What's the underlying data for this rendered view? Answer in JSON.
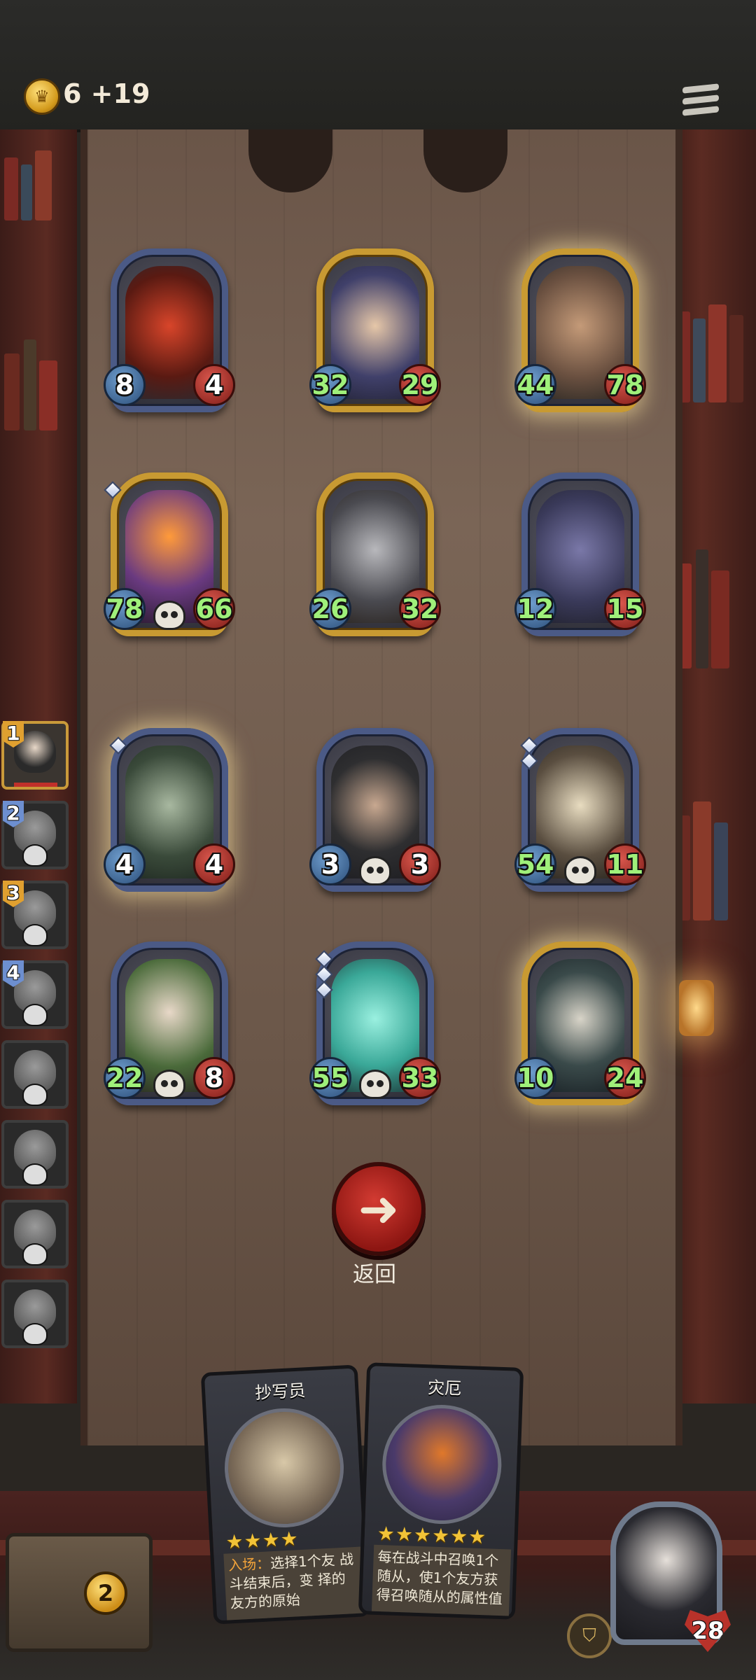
{
  "header": {
    "gold_icon": "coin-crown-icon",
    "gold_text": "6 +19",
    "menu_icon": "menu-icon"
  },
  "board_cards": [
    {
      "row": 1,
      "col": 1,
      "attack": "8",
      "health": "4",
      "frame": "blue",
      "skull": false,
      "gems": 0,
      "art": "red-dragon"
    },
    {
      "row": 1,
      "col": 2,
      "attack": "32",
      "health": "29",
      "frame": "gold",
      "skull": false,
      "gems": 0,
      "art": "helmeted-brute"
    },
    {
      "row": 1,
      "col": 3,
      "attack": "44",
      "health": "78",
      "frame": "gold",
      "skull": false,
      "gems": 0,
      "art": "bandaged-ogre"
    },
    {
      "row": 2,
      "col": 1,
      "attack": "78",
      "health": "66",
      "frame": "gold",
      "skull": true,
      "gems": 1,
      "art": "flaming-bulldog"
    },
    {
      "row": 2,
      "col": 2,
      "attack": "26",
      "health": "32",
      "frame": "gold",
      "skull": false,
      "gems": 0,
      "art": "armored-knight"
    },
    {
      "row": 2,
      "col": 3,
      "attack": "12",
      "health": "15",
      "frame": "blue",
      "skull": false,
      "gems": 0,
      "art": "bandana-rat"
    },
    {
      "row": 3,
      "col": 1,
      "attack": "4",
      "health": "4",
      "frame": "blue",
      "skull": false,
      "gems": 1,
      "art": "music-box-dancer"
    },
    {
      "row": 3,
      "col": 2,
      "attack": "3",
      "health": "3",
      "frame": "blue",
      "skull": true,
      "gems": 0,
      "art": "hooded-rogue"
    },
    {
      "row": 3,
      "col": 3,
      "attack": "54",
      "health": "11",
      "frame": "blue",
      "skull": true,
      "gems": 2,
      "art": "bone-dragon"
    },
    {
      "row": 4,
      "col": 1,
      "attack": "22",
      "health": "8",
      "frame": "blue",
      "skull": true,
      "gems": 0,
      "art": "old-woman"
    },
    {
      "row": 4,
      "col": 2,
      "attack": "55",
      "health": "33",
      "frame": "blue",
      "skull": true,
      "gems": 3,
      "art": "ghost-brute"
    },
    {
      "row": 4,
      "col": 3,
      "attack": "10",
      "health": "24",
      "frame": "gold",
      "skull": false,
      "gems": 0,
      "art": "horned-skeleton"
    }
  ],
  "roster": [
    {
      "num": "1",
      "active": true,
      "num_color": "#e0a030"
    },
    {
      "num": "2",
      "active": false,
      "num_color": "#6d8fd0"
    },
    {
      "num": "3",
      "active": false,
      "num_color": "#e0a030"
    },
    {
      "num": "4",
      "active": false,
      "num_color": "#6d8fd0"
    },
    {
      "num": "",
      "active": false,
      "num_color": ""
    },
    {
      "num": "",
      "active": false,
      "num_color": ""
    },
    {
      "num": "",
      "active": false,
      "num_color": ""
    },
    {
      "num": "",
      "active": false,
      "num_color": ""
    }
  ],
  "back_button": {
    "label": "返回",
    "icon": "arrow-left-icon"
  },
  "hand_cards": [
    {
      "name": "抄写员",
      "stars": 4,
      "desc_highlight": "入场：",
      "desc": "选择1个友 战斗结束后，变 择的友方的原始"
    },
    {
      "name": "灾厄",
      "stars": 6,
      "desc_highlight": "",
      "desc": "每在战斗中召唤1个随从，使1个友方获得召唤随从的属性值"
    }
  ],
  "bottom": {
    "chest_count": "2",
    "hero_health": "28",
    "hero_icon": "shield-icon"
  },
  "colors": {
    "gold_frame": "#c89a32",
    "blue_frame": "#4b5a86",
    "attack_orb": "#2c4f7a",
    "health_orb": "#7f1d18",
    "buffed_stat": "#9ff07a",
    "back_button": "#8d1612"
  }
}
